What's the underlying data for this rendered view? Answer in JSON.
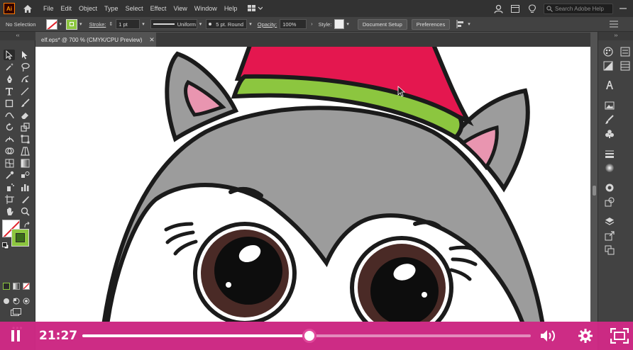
{
  "app": {
    "logo_text": "Ai",
    "menu": [
      "File",
      "Edit",
      "Object",
      "Type",
      "Select",
      "Effect",
      "View",
      "Window",
      "Help"
    ],
    "search_placeholder": "Search Adobe Help"
  },
  "control_bar": {
    "selection_label": "No Selection",
    "stroke_label": "Stroke:",
    "stroke_weight": "1 pt",
    "stroke_profile": "Uniform",
    "brush": "5 pt. Round",
    "opacity_label": "Opacity:",
    "opacity_value": "100%",
    "style_label": "Style:",
    "document_setup": "Document Setup",
    "preferences": "Preferences"
  },
  "document": {
    "tab_title": "elf.eps* @ 700 % (CMYK/CPU Preview)"
  },
  "player": {
    "state": "playing",
    "time": "21:27",
    "progress": 0.506,
    "colors": {
      "bar": "#da288b",
      "thumb_ring": "#e0489b"
    }
  },
  "colors": {
    "fill_none_slash": "#e1222a",
    "stroke_swatch": "#8cc63f",
    "hat_red": "#e4174f",
    "hat_band": "#8cc63f",
    "face_gray": "#9c9c9c",
    "ear_inner": "#e995b0",
    "outline": "#1b1b1b",
    "iris": "#4a2a26"
  }
}
